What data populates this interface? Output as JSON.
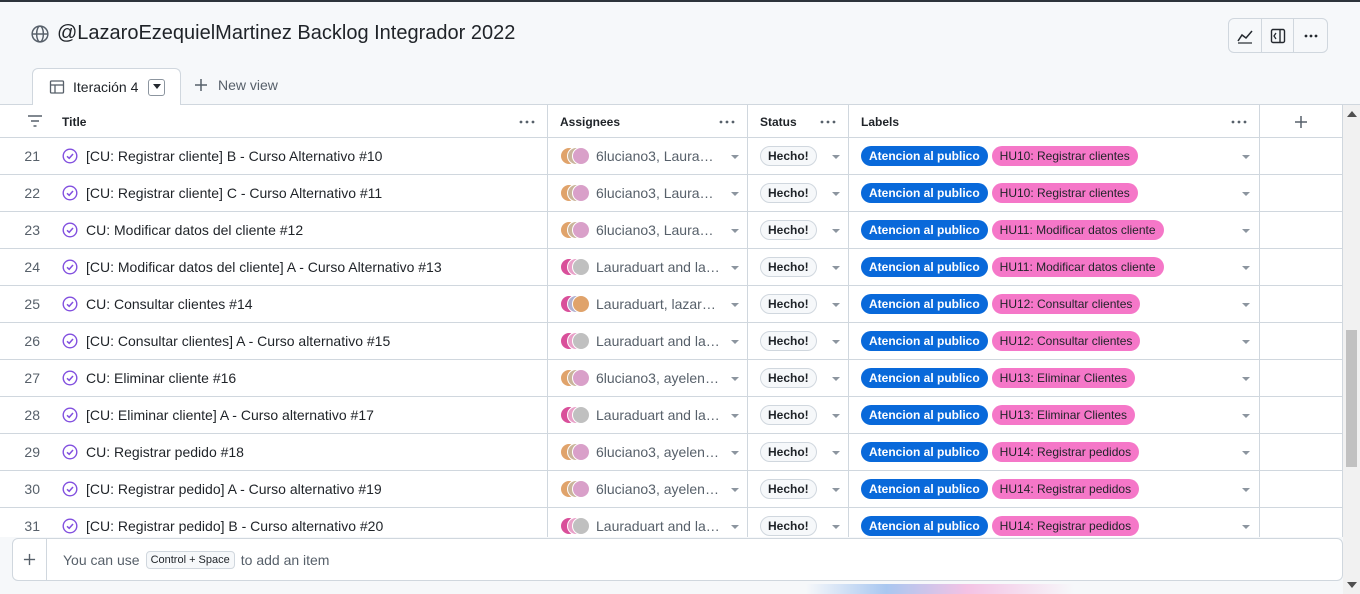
{
  "header": {
    "title": "@LazaroEzequielMartinez Backlog Integrador 2022",
    "tools": [
      "insights-icon",
      "side-panel-icon",
      "more-icon"
    ]
  },
  "tabs": {
    "active_label": "Iteración 4",
    "new_view_label": "New view"
  },
  "columns": {
    "title": "Title",
    "assignees": "Assignees",
    "status": "Status",
    "labels": "Labels"
  },
  "rows": [
    {
      "num": "21",
      "title": "[CU: Registrar cliente] B - Curso Alternativo  #10",
      "assignees": "6luciano3, Laurad…",
      "avatar": "a",
      "status": "Hecho!",
      "label1": "Atencion al publico",
      "label2": "HU10: Registrar clientes"
    },
    {
      "num": "22",
      "title": "[CU: Registrar cliente] C - Curso Alternativo  #11",
      "assignees": "6luciano3, Laurad…",
      "avatar": "a",
      "status": "Hecho!",
      "label1": "Atencion al publico",
      "label2": "HU10: Registrar clientes"
    },
    {
      "num": "23",
      "title": "CU: Modificar datos del cliente  #12",
      "assignees": "6luciano3, Laurad…",
      "avatar": "a",
      "status": "Hecho!",
      "label1": "Atencion al publico",
      "label2": "HU11: Modificar datos cliente"
    },
    {
      "num": "24",
      "title": "[CU: Modificar datos del cliente] A - Curso Alternativo  #13",
      "assignees": "Lauraduart and laza…",
      "avatar": "b",
      "status": "Hecho!",
      "label1": "Atencion al publico",
      "label2": "HU11: Modificar datos cliente"
    },
    {
      "num": "25",
      "title": "CU: Consultar clientes  #14",
      "assignees": "Lauraduart, lazaro…",
      "avatar": "c",
      "status": "Hecho!",
      "label1": "Atencion al publico",
      "label2": "HU12: Consultar clientes"
    },
    {
      "num": "26",
      "title": "[CU: Consultar clientes] A - Curso alternativo  #15",
      "assignees": "Lauraduart and laza…",
      "avatar": "b",
      "status": "Hecho!",
      "label1": "Atencion al publico",
      "label2": "HU12: Consultar clientes"
    },
    {
      "num": "27",
      "title": "CU: Eliminar cliente  #16",
      "assignees": "6luciano3, ayelenc…",
      "avatar": "a",
      "status": "Hecho!",
      "label1": "Atencion al publico",
      "label2": "HU13: Eliminar Clientes"
    },
    {
      "num": "28",
      "title": "[CU: Eliminar cliente] A - Curso alternativo  #17",
      "assignees": "Lauraduart and laza…",
      "avatar": "b",
      "status": "Hecho!",
      "label1": "Atencion al publico",
      "label2": "HU13: Eliminar Clientes"
    },
    {
      "num": "29",
      "title": "CU: Registrar pedido  #18",
      "assignees": "6luciano3, ayelenc…",
      "avatar": "a",
      "status": "Hecho!",
      "label1": "Atencion al publico",
      "label2": "HU14: Registrar pedidos"
    },
    {
      "num": "30",
      "title": "[CU: Registrar pedido] A - Curso alternativo  #19",
      "assignees": "6luciano3, ayelenc…",
      "avatar": "a",
      "status": "Hecho!",
      "label1": "Atencion al publico",
      "label2": "HU14: Registrar pedidos"
    },
    {
      "num": "31",
      "title": "[CU: Registrar pedido] B - Curso alternativo  #20",
      "assignees": "Lauraduart and laza…",
      "avatar": "b",
      "status": "Hecho!",
      "label1": "Atencion al publico",
      "label2": "HU14: Registrar pedidos"
    }
  ],
  "add_item": {
    "prefix": "You can use",
    "shortcut": "Control + Space",
    "suffix": "to add an item"
  },
  "colors": {
    "label_blue": "#0969da",
    "label_pink": "#f577c8",
    "issue_done_purple": "#8250df"
  }
}
